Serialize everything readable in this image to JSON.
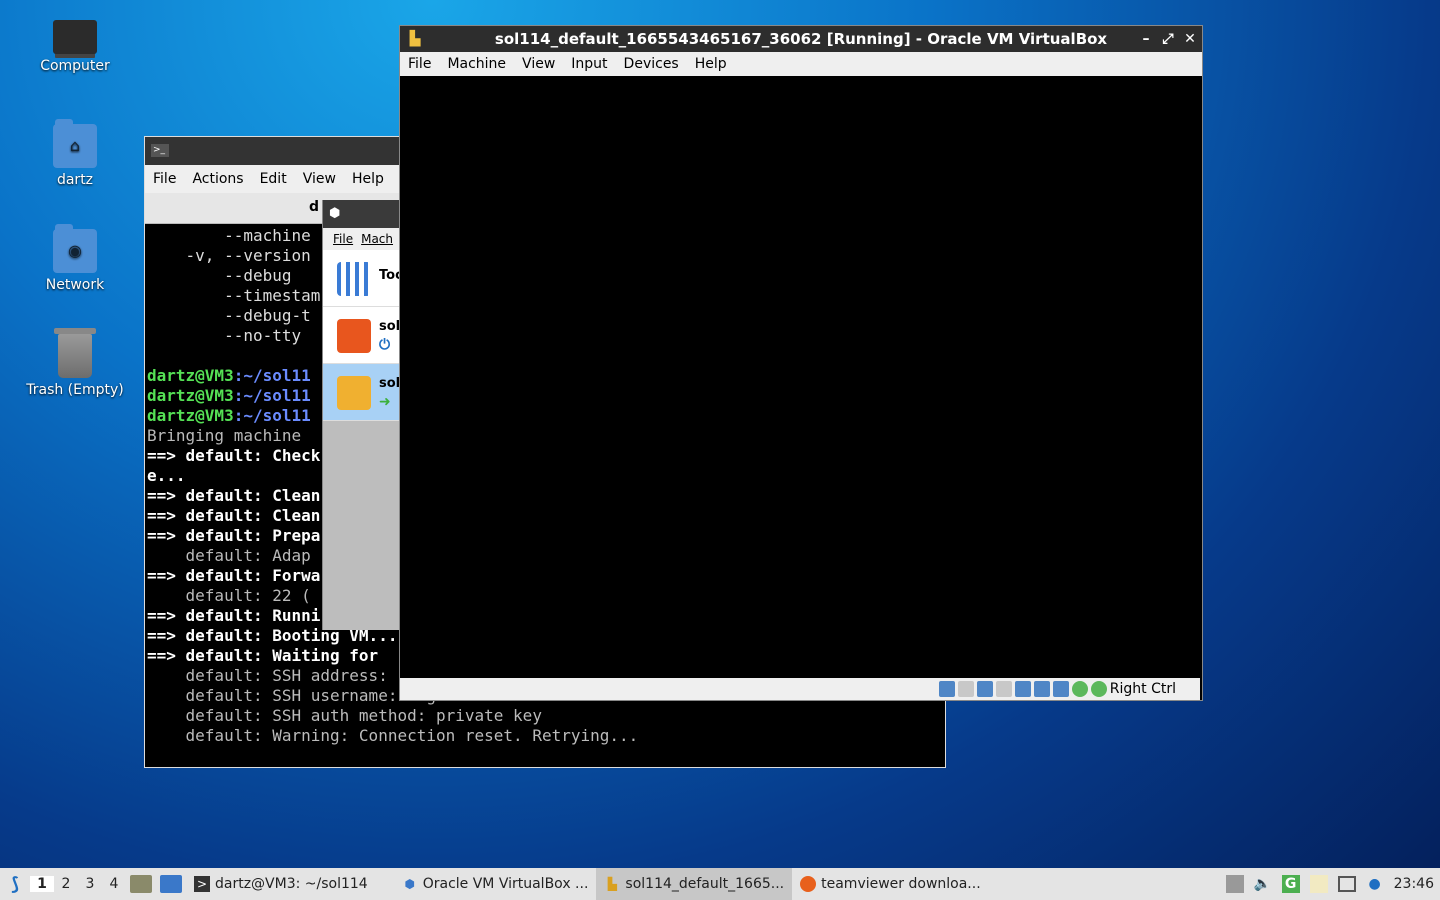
{
  "desktop": {
    "icons": [
      {
        "label": "Computer"
      },
      {
        "label": "dartz"
      },
      {
        "label": "Network"
      },
      {
        "label": "Trash (Empty)"
      }
    ]
  },
  "terminal": {
    "menu": [
      "File",
      "Actions",
      "Edit",
      "View",
      "Help"
    ],
    "tab_title": "d",
    "lines": [
      {
        "kind": "plain",
        "text": "        --machine"
      },
      {
        "kind": "plain",
        "text": "    -v, --version"
      },
      {
        "kind": "plain",
        "text": "        --debug"
      },
      {
        "kind": "plain",
        "text": "        --timestam"
      },
      {
        "kind": "plain",
        "text": "        --debug-t"
      },
      {
        "kind": "plain",
        "text": "        --no-tty"
      },
      {
        "kind": "plain",
        "text": ""
      },
      {
        "kind": "prompt",
        "user": "dartz@VM3",
        "path": ":~/sol11"
      },
      {
        "kind": "prompt",
        "user": "dartz@VM3",
        "path": ":~/sol11"
      },
      {
        "kind": "prompt",
        "user": "dartz@VM3",
        "path": ":~/sol11"
      },
      {
        "kind": "dim",
        "text": "Bringing machine"
      },
      {
        "kind": "bold",
        "text": "==> default: Check"
      },
      {
        "kind": "bold",
        "text": "e..."
      },
      {
        "kind": "bold",
        "text": "==> default: Clean"
      },
      {
        "kind": "bold",
        "text": "==> default: Clean"
      },
      {
        "kind": "bold",
        "text": "==> default: Prepa"
      },
      {
        "kind": "dim",
        "text": "    default: Adap"
      },
      {
        "kind": "bold",
        "text": "==> default: Forwa"
      },
      {
        "kind": "dim",
        "text": "    default: 22 ("
      },
      {
        "kind": "bold",
        "text": "==> default: Runni"
      },
      {
        "kind": "bold",
        "text": "==> default: Booting VM..."
      },
      {
        "kind": "bold",
        "text": "==> default: Waiting for"
      },
      {
        "kind": "dim",
        "text": "    default: SSH address:"
      },
      {
        "kind": "dim",
        "text": "    default: SSH username: vagrant"
      },
      {
        "kind": "dim",
        "text": "    default: SSH auth method: private key"
      },
      {
        "kind": "dim",
        "text": "    default: Warning: Connection reset. Retrying..."
      }
    ]
  },
  "vbox_manager": {
    "menu": [
      "File",
      "Mach"
    ],
    "items": [
      {
        "label": "Too"
      },
      {
        "label": "sol"
      },
      {
        "label": "sol"
      }
    ]
  },
  "vm_window": {
    "title": "sol114_default_1665543465167_36062 [Running] - Oracle VM VirtualBox",
    "menu": [
      "File",
      "Machine",
      "View",
      "Input",
      "Devices",
      "Help"
    ],
    "host_key": "Right Ctrl"
  },
  "taskbar": {
    "workspaces": [
      "1",
      "2",
      "3",
      "4"
    ],
    "tasks": [
      {
        "label": "dartz@VM3: ~/sol114"
      },
      {
        "label": "Oracle VM VirtualBox ..."
      },
      {
        "label": "sol114_default_1665..."
      },
      {
        "label": "teamviewer downloa..."
      }
    ],
    "clock": "23:46"
  }
}
